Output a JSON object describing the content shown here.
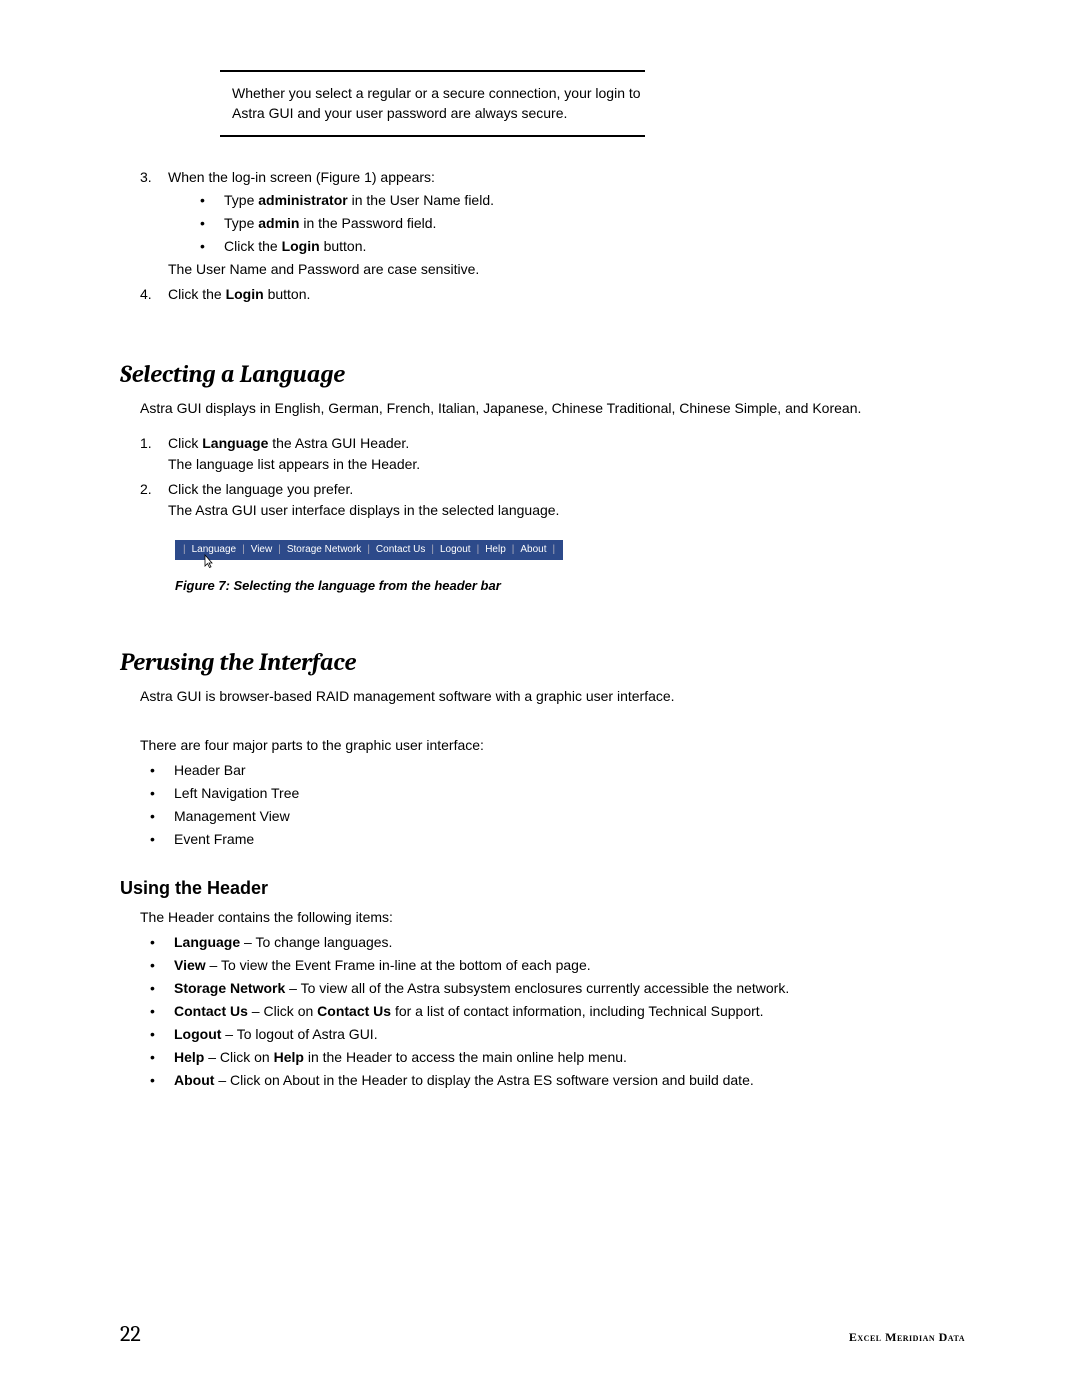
{
  "note": "Whether you select a regular or a secure connection, your login to Astra GUI and your user password are always secure.",
  "steps_a": {
    "item3": {
      "num": "3.",
      "lead": "When the log-in screen (Figure 1) appears:",
      "bullets": {
        "b1_pre": "Type ",
        "b1_bold": "administrator",
        "b1_post": " in the User Name field.",
        "b2_pre": "Type ",
        "b2_bold": "admin",
        "b2_post": " in the Password field.",
        "b3_pre": "Click the ",
        "b3_bold": "Login",
        "b3_post": " button."
      },
      "tail": "The User Name and Password are case sensitive."
    },
    "item4": {
      "num": "4.",
      "pre": "Click the ",
      "bold": "Login",
      "post": " button."
    }
  },
  "section_lang": {
    "heading": "Selecting a Language",
    "intro": "Astra GUI displays in English, German, French, Italian, Japanese, Chinese Traditional, Chinese Simple, and Korean.",
    "step1": {
      "num": "1.",
      "pre": "Click ",
      "bold": "Language",
      "post": " the Astra GUI Header.",
      "tail": "The language list appears in the Header."
    },
    "step2": {
      "num": "2.",
      "text": "Click the language you prefer.",
      "tail": "The Astra GUI user interface displays in the selected language."
    }
  },
  "header_bar": {
    "items": [
      "Language",
      "View",
      "Storage Network",
      "Contact Us",
      "Logout",
      "Help",
      "About"
    ]
  },
  "figure_caption": "Figure 7: Selecting the language from the header bar",
  "section_perusing": {
    "heading": "Perusing the Interface",
    "intro": "Astra GUI is browser-based RAID management software with a graphic user interface.",
    "parts_intro": "There are four major parts to the graphic user interface:",
    "parts": [
      "Header Bar",
      "Left Navigation Tree",
      "Management View",
      "Event Frame"
    ]
  },
  "using_header": {
    "heading": "Using the Header",
    "intro": "The Header contains the following items:",
    "items": {
      "language": {
        "bold": "Language",
        "text": " – To change languages."
      },
      "view": {
        "bold": "View",
        "text": " – To view the Event Frame in-line at the bottom of each page."
      },
      "storage": {
        "bold": "Storage Network",
        "text": " – To view all of the Astra subsystem enclosures currently accessible the network."
      },
      "contact": {
        "bold": "Contact Us",
        "pre": " – Click on ",
        "bold2": "Contact Us",
        "post": " for a list of contact information, including Technical Support."
      },
      "logout": {
        "bold": "Logout",
        "text": " – To logout of Astra GUI."
      },
      "help": {
        "bold": "Help",
        "pre": " – Click on ",
        "bold2": "Help",
        "post": " in the Header to access the main online help menu."
      },
      "about": {
        "bold": "About",
        "text": " – Click on About in the Header to display the Astra ES software version and build date."
      }
    }
  },
  "footer": {
    "page": "22",
    "text": "Excel Meridian Data"
  }
}
